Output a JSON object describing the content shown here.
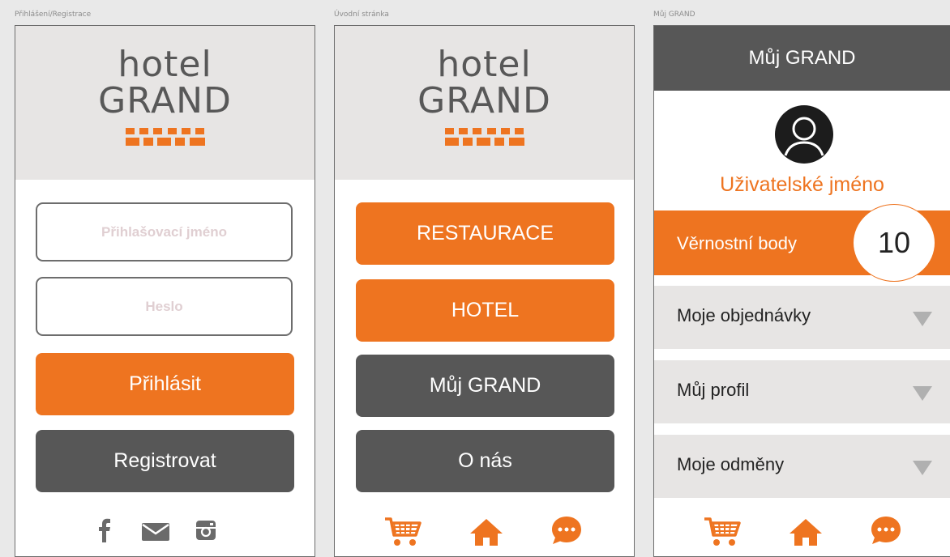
{
  "frames": [
    {
      "caption": "Přihlášení/Registrace"
    },
    {
      "caption": "Úvodní stránka"
    },
    {
      "caption": "Můj GRAND"
    }
  ],
  "logo": {
    "line1": "hotel",
    "line2": "GRAND"
  },
  "login": {
    "username_placeholder": "Přihlašovací jméno",
    "password_placeholder": "Heslo",
    "login_label": "Přihlásit",
    "register_label": "Registrovat",
    "social_icons": [
      "facebook-icon",
      "mail-icon",
      "instagram-icon"
    ]
  },
  "home": {
    "buttons": [
      {
        "label": "RESTAURACE",
        "color": "#ee7420"
      },
      {
        "label": "HOTEL",
        "color": "#ee7420"
      },
      {
        "label": "Můj GRAND",
        "color": "#575757"
      },
      {
        "label": "O nás",
        "color": "#575757"
      }
    ],
    "bottom_icons": [
      "cart-icon",
      "home-icon",
      "chat-icon"
    ]
  },
  "profile": {
    "title": "Můj GRAND",
    "username": "Uživatelské jméno",
    "loyalty_label": "Věrnostní body",
    "loyalty_points": "10",
    "menu": [
      {
        "label": "Moje objednávky"
      },
      {
        "label": "Můj profil"
      },
      {
        "label": "Moje odměny"
      }
    ],
    "bottom_icons": [
      "cart-icon",
      "home-icon",
      "chat-icon"
    ]
  },
  "colors": {
    "accent": "#ee7420",
    "dark": "#575757",
    "panel": "#e7e5e4"
  }
}
